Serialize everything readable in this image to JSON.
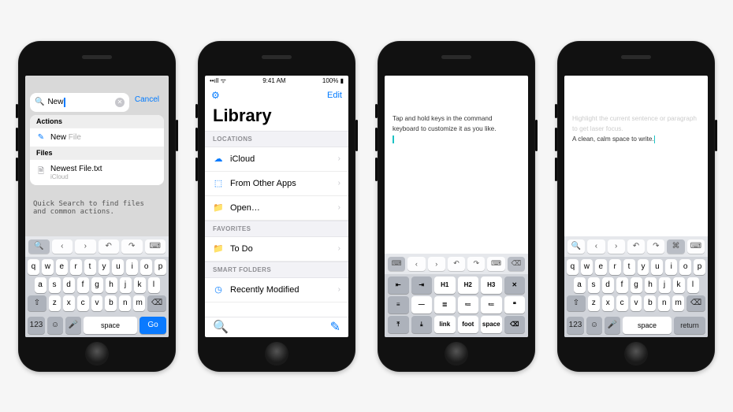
{
  "screen1": {
    "search_query": "New",
    "cancel": "Cancel",
    "sections": [
      {
        "header": "Actions",
        "rows": [
          {
            "icon": "compose",
            "label_a": "New",
            "label_b": " File"
          }
        ]
      },
      {
        "header": "Files",
        "rows": [
          {
            "icon": "doc",
            "label_a": "Newest File.txt",
            "sub": "iCloud"
          }
        ]
      }
    ],
    "body_text": "Quick Search to find files and common actions."
  },
  "screen2": {
    "status_time": "9:41 AM",
    "status_right": "100%",
    "edit": "Edit",
    "title": "Library",
    "sections": [
      {
        "header": "LOCATIONS",
        "rows": [
          {
            "icon": "cloud",
            "label": "iCloud"
          },
          {
            "icon": "tray",
            "label": "From Other Apps"
          },
          {
            "icon": "folder",
            "label": "Open…"
          }
        ]
      },
      {
        "header": "FAVORITES",
        "rows": [
          {
            "icon": "folder",
            "label": "To Do"
          }
        ]
      },
      {
        "header": "SMART FOLDERS",
        "rows": [
          {
            "icon": "clock",
            "label": "Recently Modified"
          }
        ]
      }
    ]
  },
  "screen3": {
    "text": "Tap and hold keys in the command keyboard to customize it as you like.",
    "grid": [
      [
        "indent-out",
        "indent-in",
        "H1",
        "H2",
        "H3",
        "x-icon"
      ],
      [
        "align-l",
        "hr",
        "ul",
        "ol",
        "ol",
        "quote"
      ],
      [
        "move-up",
        "move-dn",
        "link",
        "foot",
        "space",
        "bksp"
      ]
    ]
  },
  "screen4": {
    "faded": "Highlight the current sentence or paragraph to get laser focus.",
    "text": "A clean, calm space to write."
  },
  "qwerty": {
    "row1": [
      "q",
      "w",
      "e",
      "r",
      "t",
      "y",
      "u",
      "i",
      "o",
      "p"
    ],
    "row2": [
      "a",
      "s",
      "d",
      "f",
      "g",
      "h",
      "j",
      "k",
      "l"
    ],
    "row3": [
      "z",
      "x",
      "c",
      "v",
      "b",
      "n",
      "m"
    ],
    "num": "123",
    "space": "space",
    "go": "Go",
    "return": "return"
  },
  "accessory_icons": [
    "search",
    "chev-left",
    "chev-right",
    "undo",
    "redo",
    "keyboard-down"
  ],
  "accessory_icons3": [
    "kb",
    "chev-left",
    "chev-right",
    "undo",
    "redo",
    "keyboard-down",
    "delete"
  ]
}
